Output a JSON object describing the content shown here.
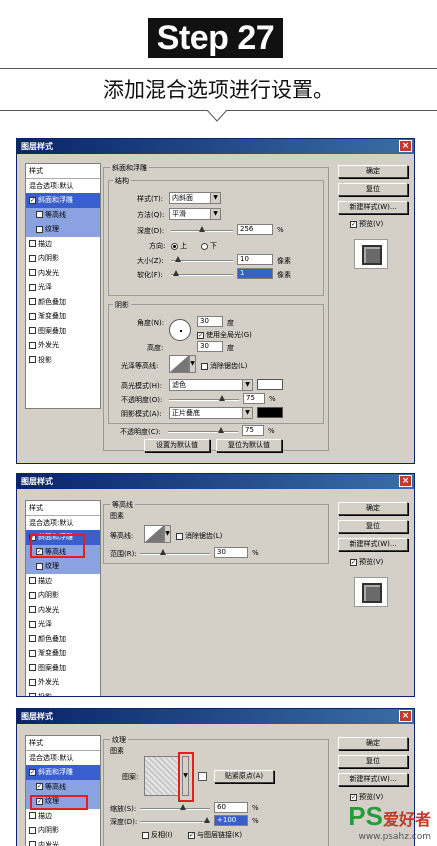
{
  "header": {
    "step": "Step 27",
    "subtitle": "添加混合选项进行设置。"
  },
  "dialog_title": "图层样式",
  "style_list": {
    "head": "样式",
    "blend": "混合选项:默认",
    "items": [
      "斜面和浮雕",
      "等高线",
      "纹理",
      "描边",
      "内阴影",
      "内发光",
      "光泽",
      "颜色叠加",
      "渐变叠加",
      "图案叠加",
      "外发光",
      "投影"
    ]
  },
  "right_buttons": {
    "ok": "确定",
    "reset": "复位",
    "new_style": "新建样式(W)...",
    "preview": "预览(V)"
  },
  "panel1": {
    "section": "斜面和浮雕",
    "struct": "结构",
    "style_label": "样式(T):",
    "style_value": "内斜面",
    "method_label": "方法(Q):",
    "method_value": "平滑",
    "depth_label": "深度(D):",
    "depth_value": "256",
    "depth_unit": "%",
    "direction_label": "方向:",
    "dir_up": "上",
    "dir_down": "下",
    "size_label": "大小(Z):",
    "size_value": "10",
    "size_unit": "像素",
    "soften_label": "软化(F):",
    "soften_value": "1",
    "soften_unit": "像素",
    "shading": "阴影",
    "angle_label": "角度(N):",
    "angle_value": "30",
    "angle_unit": "度",
    "global_light": "使用全局光(G)",
    "altitude_label": "高度:",
    "altitude_value": "30",
    "altitude_unit": "度",
    "gloss_label": "光泽等高线:",
    "antialias": "消除锯齿(L)",
    "hl_mode_label": "高光模式(H):",
    "hl_mode_value": "滤色",
    "hl_op_label": "不透明度(O):",
    "hl_op_value": "75",
    "hl_op_unit": "%",
    "sh_mode_label": "阴影模式(A):",
    "sh_mode_value": "正片叠底",
    "sh_op_label": "不透明度(C):",
    "sh_op_value": "75",
    "sh_op_unit": "%",
    "make_default": "设置为默认值",
    "reset_default": "复位为默认值"
  },
  "panel2": {
    "section": "等高线",
    "elements": "图素",
    "contour_label": "等高线:",
    "antialias": "消除锯齿(L)",
    "range_label": "范围(R):",
    "range_value": "30",
    "range_unit": "%"
  },
  "panel3": {
    "section": "纹理",
    "elements": "图素",
    "pattern_label": "图案:",
    "snap": "贴紧原点(A)",
    "scale_label": "缩放(S):",
    "scale_value": "60",
    "scale_unit": "%",
    "depth_label": "深度(D):",
    "depth_value": "+100",
    "depth_unit": "%",
    "invert": "反相(I)",
    "link": "与图层链接(K)"
  },
  "watermark": {
    "ps": "PS",
    "cn": "爱好者",
    "url": "www.psahz.com"
  },
  "colors": {
    "title_bar": "#0a246a",
    "selection": "#3a5fcd",
    "highlight_box": "#e02020",
    "dialog_bg": "#d4d0c8"
  }
}
